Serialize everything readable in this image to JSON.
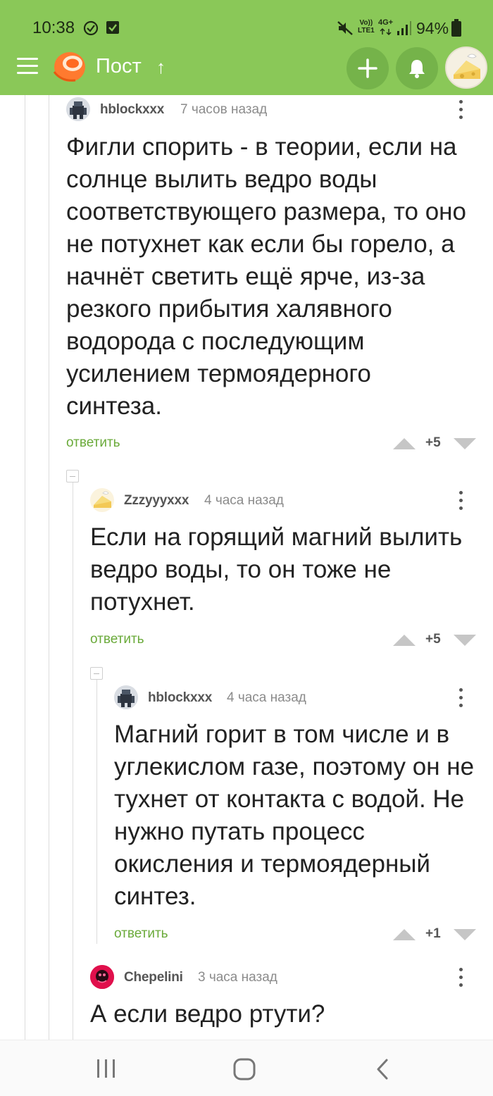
{
  "status_bar": {
    "time": "10:38",
    "network_label_top": "Vo))",
    "network_label_bottom": "LTE1",
    "network_gen": "4G+",
    "battery": "94%"
  },
  "app_bar": {
    "title": "Пост",
    "up_arrow": "↑",
    "accent_color": "#8ac858"
  },
  "comments": [
    {
      "user": "hblockxxx",
      "time": "7 часов назад",
      "text": "Фигли спорить - в теории, если на солнце вылить ведро воды соответствующего размера, то оно не потухнет как если бы горело, а начнёт светить ещё ярче, из-за резкого прибытия халявного водорода с последующим усилением термоядерного синтеза.",
      "reply": "ответить",
      "score": "+5",
      "avatar_icon": "robot-avatar-icon"
    },
    {
      "user": "Zzzyyyxxx",
      "time": "4 часа назад",
      "text": "Если на горящий магний вылить ведро воды, то он тоже не потухнет.",
      "reply": "ответить",
      "score": "+5",
      "avatar_icon": "cheese-avatar-icon"
    },
    {
      "user": "hblockxxx",
      "time": "4 часа назад",
      "text": "Магний горит в том числе и в углекислом газе, поэтому он не тухнет от контакта с водой. Не нужно путать процесс окисления и термоядерный синтез.",
      "reply": "ответить",
      "score": "+1",
      "avatar_icon": "robot-avatar-icon"
    },
    {
      "user": "Chepelini",
      "time": "3 часа назад",
      "text": "А если ведро ртути?",
      "avatar_icon": "pink-avatar-icon"
    }
  ],
  "nav_bar": {
    "recents_icon": "recents-icon",
    "home_icon": "home-icon",
    "back_icon": "back-icon"
  }
}
